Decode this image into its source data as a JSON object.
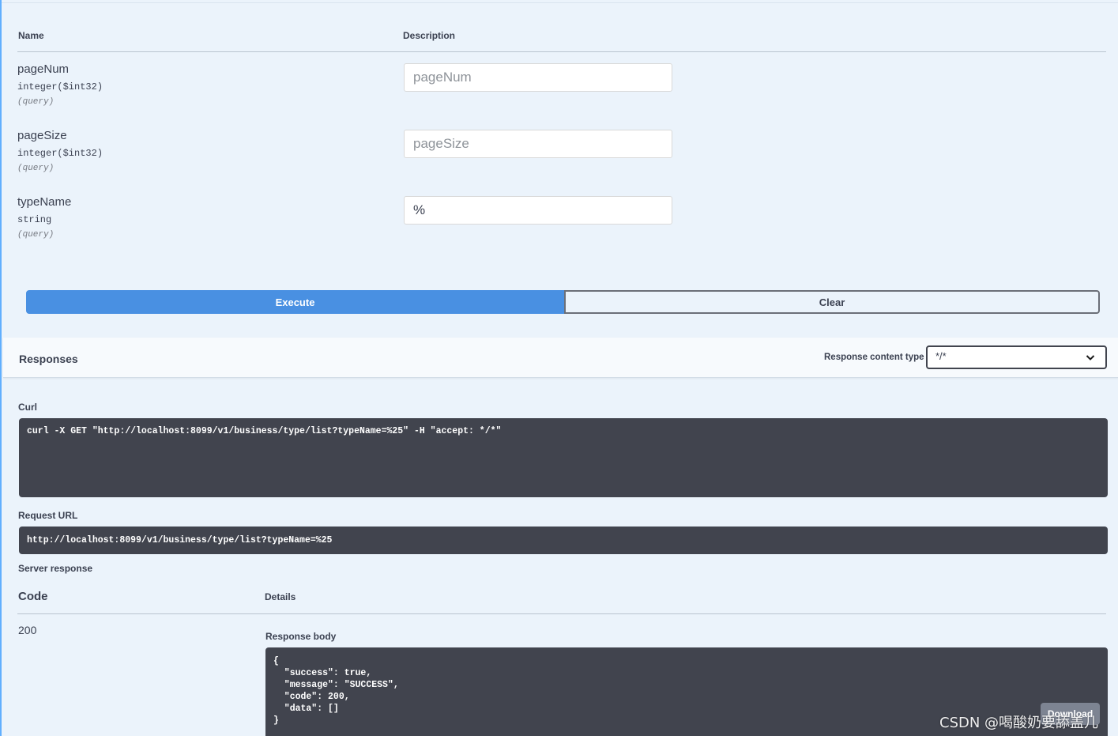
{
  "parameters": {
    "name_header": "Name",
    "description_header": "Description",
    "items": [
      {
        "name": "pageNum",
        "type": "integer($int32)",
        "in": "(query)",
        "placeholder": "pageNum",
        "value": ""
      },
      {
        "name": "pageSize",
        "type": "integer($int32)",
        "in": "(query)",
        "placeholder": "pageSize",
        "value": ""
      },
      {
        "name": "typeName",
        "type": "string",
        "in": "(query)",
        "placeholder": "typeName",
        "value": "%"
      }
    ]
  },
  "actions": {
    "execute_label": "Execute",
    "clear_label": "Clear",
    "execute_color": "#4990e2"
  },
  "responses": {
    "title": "Responses",
    "content_type_label": "Response content type",
    "content_type_value": "*/*"
  },
  "curl": {
    "label": "Curl",
    "command": "curl -X GET \"http://localhost:8099/v1/business/type/list?typeName=%25\" -H \"accept: */*\""
  },
  "request_url": {
    "label": "Request URL",
    "url": "http://localhost:8099/v1/business/type/list?typeName=%25"
  },
  "server_response": {
    "label": "Server response",
    "code_header": "Code",
    "details_header": "Details",
    "code": "200",
    "body_label": "Response body",
    "body": "{\n  \"success\": true,\n  \"message\": \"SUCCESS\",\n  \"code\": 200,\n  \"data\": []\n}",
    "download_label": "Download"
  },
  "watermark": "CSDN @喝酸奶要舔盖儿",
  "colors": {
    "background": "#ebf3fb",
    "code_bg": "#41444e",
    "accent": "#61affe"
  }
}
